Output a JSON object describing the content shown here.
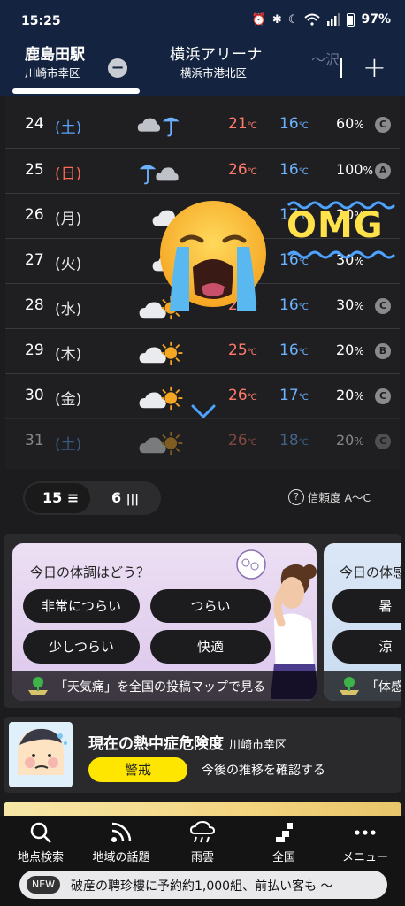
{
  "status_bar": {
    "time": "15:25",
    "battery": "97%"
  },
  "header": {
    "tabs": [
      {
        "name": "鹿島田駅",
        "sub": "川崎市幸区"
      },
      {
        "name": "横浜アリーナ",
        "sub": "横浜市港北区"
      },
      {
        "name": "〜沢"
      }
    ],
    "minus_label": "−",
    "plus_label": "+"
  },
  "forecast": {
    "temp_unit": "℃",
    "pct_unit": "%",
    "rows": [
      {
        "date": "24",
        "dow": "(土)",
        "day_type": "sat",
        "icon": "cloud-rain-icon",
        "hi": "21",
        "lo": "16",
        "pop": "60",
        "rank": "C"
      },
      {
        "date": "25",
        "dow": "(日)",
        "day_type": "sun",
        "icon": "rain-cloud-icon",
        "hi": "26",
        "lo": "16",
        "pop": "100",
        "rank": "A"
      },
      {
        "date": "26",
        "dow": "(月)",
        "day_type": "wk",
        "icon": "cloud-icon",
        "hi": "",
        "lo": "17",
        "pop": "20",
        "rank": ""
      },
      {
        "date": "27",
        "dow": "(火)",
        "day_type": "wk",
        "icon": "cloud-icon",
        "hi": "",
        "lo": "16",
        "pop": "30",
        "rank": ""
      },
      {
        "date": "28",
        "dow": "(水)",
        "day_type": "wk",
        "icon": "cloud-sun-icon",
        "hi": "24",
        "lo": "16",
        "pop": "30",
        "rank": "C"
      },
      {
        "date": "29",
        "dow": "(木)",
        "day_type": "wk",
        "icon": "cloud-sun-icon",
        "hi": "25",
        "lo": "16",
        "pop": "20",
        "rank": "B"
      },
      {
        "date": "30",
        "dow": "(金)",
        "day_type": "wk",
        "icon": "cloud-sun-icon",
        "hi": "26",
        "lo": "17",
        "pop": "20",
        "rank": "C"
      },
      {
        "date": "31",
        "dow": "(土)",
        "day_type": "sat",
        "icon": "cloud-sun-icon",
        "hi": "26",
        "lo": "18",
        "pop": "20",
        "rank": "C"
      }
    ]
  },
  "overlay": {
    "emoji": "loudly-crying-face-emoji",
    "text": "OMG"
  },
  "toggle": {
    "option_a": "15",
    "option_b": "6",
    "reliability": "信頼度 A〜C"
  },
  "condition_card": {
    "title": "今日の体調はどう？",
    "options": [
      "非常につらい",
      "つらい",
      "少しつらい",
      "快適"
    ],
    "footer": "「天気痛」を全国の投稿マップで見る",
    "next_title": "今日の体感",
    "next_options": [
      "暑",
      "涼"
    ],
    "next_footer": "「体感"
  },
  "heatstroke": {
    "title": "現在の熱中症危険度",
    "location": "川崎市幸区",
    "level": "警戒",
    "link": "今後の推移を確認する"
  },
  "bottom_nav": {
    "items": [
      "地点検索",
      "地域の話題",
      "雨雲",
      "全国",
      "メニュー"
    ]
  },
  "news": {
    "badge": "NEW",
    "text": "破産の聘珍樓に予約約1,000組、前払い客も 〜"
  },
  "colors": {
    "header_bg": "#14233f",
    "hi_temp": "#ff7a6b",
    "lo_temp": "#6cb2ff",
    "saturday": "#5aa3ff",
    "sunday": "#ff6a55",
    "alert_yellow": "#ffe600"
  }
}
